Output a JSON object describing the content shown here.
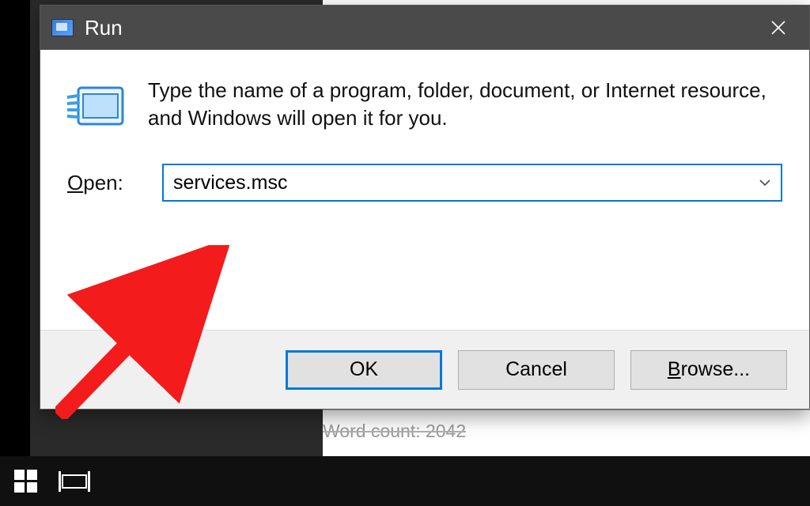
{
  "dialog": {
    "title": "Run",
    "description": "Type the name of a program, folder, document, or Internet resource, and Windows will open it for you.",
    "open_label_pre": "O",
    "open_label_post": "pen:",
    "input_value": "services.msc",
    "buttons": {
      "ok": "OK",
      "cancel": "Cancel",
      "browse_pre": "B",
      "browse_post": "rowse..."
    }
  },
  "background": {
    "wordcount_text": "Word count: 2042"
  }
}
